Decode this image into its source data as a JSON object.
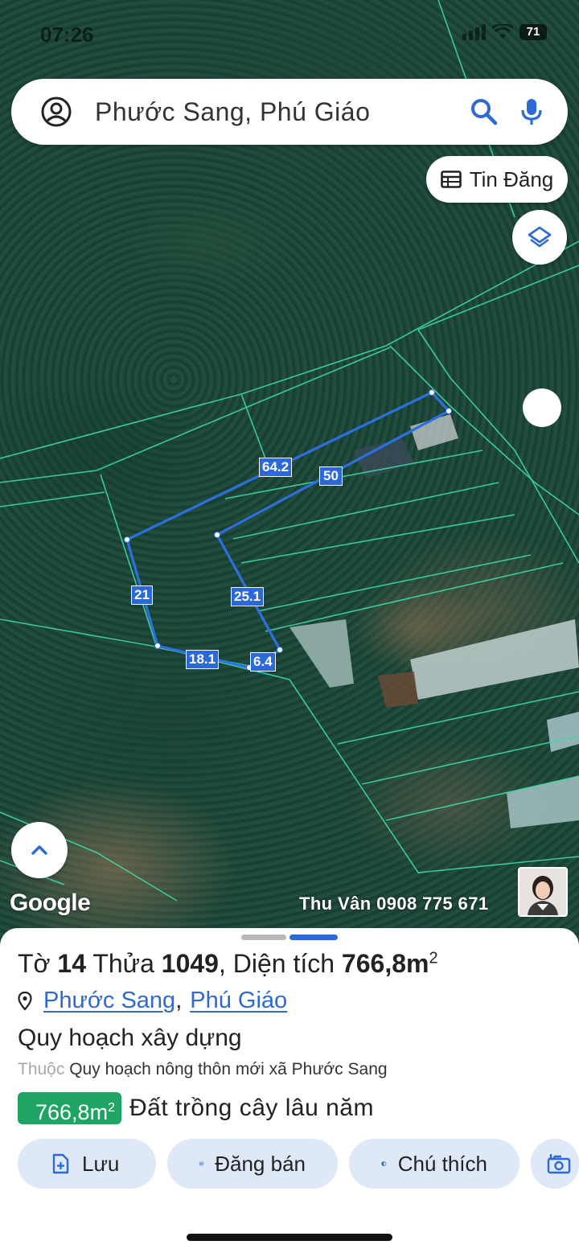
{
  "status_bar": {
    "time": "07:26",
    "battery": "71"
  },
  "search": {
    "query": "Phước Sang, Phú Giáo"
  },
  "map_buttons": {
    "listings_label": "Tin Đăng"
  },
  "map": {
    "measurements": [
      "64.2",
      "50",
      "21",
      "25.1",
      "18.1",
      "6.4"
    ],
    "google_logo": "Google",
    "watermark": "Thu Vân 0908 775 671"
  },
  "parcel": {
    "sheet_label": "Tờ",
    "sheet_no": "14",
    "lot_label": "Thửa",
    "lot_no": "1049",
    "area_label": ", Diện tích",
    "area_value": "766,8m",
    "area_sup": "2",
    "commune": "Phước Sang",
    "district": "Phú Giáo",
    "separator": ",",
    "plan_title": "Quy hoạch xây dựng",
    "belongs_prefix": "Thuộc",
    "belongs_text": "Quy hoạch nông thôn mới xã Phước Sang",
    "land_area": "766,8m",
    "land_area_sup": "2",
    "land_type": "Đất trồng cây lâu năm"
  },
  "actions": {
    "save": "Lưu",
    "sell": "Đăng bán",
    "legend": "Chú thích"
  },
  "colors": {
    "accent_blue": "#2e6ad2",
    "land_green": "#20a464",
    "parcel_line": "#2d6fe0",
    "cadastral_line": "#3fd6a8"
  }
}
